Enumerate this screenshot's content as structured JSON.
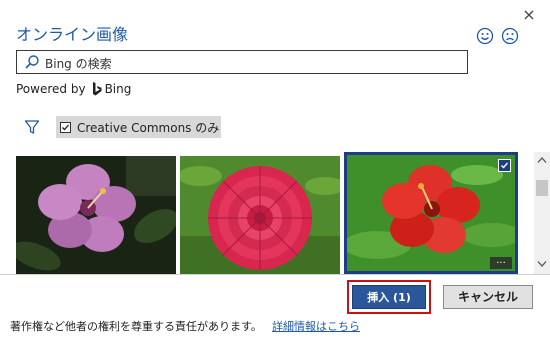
{
  "dialog": {
    "title": "オンライン画像",
    "close_glyph": "×"
  },
  "search": {
    "placeholder": "Bing の検索"
  },
  "powered": {
    "prefix": "Powered by",
    "brand": "Bing"
  },
  "filter": {
    "chip_label": "Creative Commons のみ",
    "checked": true
  },
  "gallery": {
    "images": [
      {
        "name": "pink hibiscus",
        "selected": false
      },
      {
        "name": "red dahlia",
        "selected": false
      },
      {
        "name": "red hibiscus",
        "selected": true
      }
    ],
    "more_glyph": "..."
  },
  "buttons": {
    "insert_label": "挿入 (1)",
    "cancel_label": "キャンセル"
  },
  "footer": {
    "notice": "著作権など他者の権利を尊重する責任があります。",
    "link_label": "詳細情報はこちら"
  },
  "colors": {
    "accent": "#1f5aa6",
    "insert_bg": "#2b579a",
    "highlight_frame": "#d01010"
  },
  "icons": [
    "close-icon",
    "smiley-happy-icon",
    "smiley-sad-icon",
    "search-icon",
    "bing-logo-icon",
    "filter-icon",
    "checkbox-checked-icon",
    "more-options-icon",
    "scroll-up-icon",
    "scroll-down-icon"
  ]
}
